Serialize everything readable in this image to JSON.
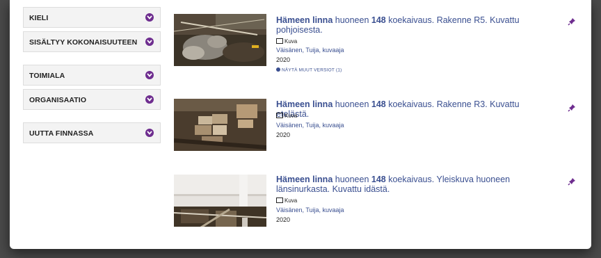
{
  "facets": [
    {
      "label": "KIELI"
    },
    {
      "label": "SISÄLTYY KOKONAISUUTEEN"
    },
    {
      "label": "TOIMIALA"
    },
    {
      "label": "ORGANISAATIO"
    },
    {
      "label": "UUTTA FINNASSA"
    }
  ],
  "results": [
    {
      "title_prefix": "Hämeen linna",
      "title_mid": " huoneen ",
      "title_num": "148",
      "title_rest": " koekaivaus. Rakenne R5. Kuvattu pohjoisesta.",
      "format": "Kuva",
      "author": "Väisänen, Tuija, kuvaaja",
      "year": "2020",
      "versions": "NÄYTÄ MUUT VERSIOT (1)"
    },
    {
      "title_prefix": "Hämeen linna",
      "title_mid": " huoneen ",
      "title_num": "148",
      "title_rest": " koekaivaus. Rakenne R3. Kuvattu etelästä.",
      "format": "Kuva",
      "author": "Väisänen, Tuija, kuvaaja",
      "year": "2020"
    },
    {
      "title_prefix": "Hämeen linna",
      "title_mid": " huoneen ",
      "title_num": "148",
      "title_rest": " koekaivaus. Yleiskuva huoneen länsinurkasta. Kuvattu idästä.",
      "format": "Kuva",
      "author": "Väisänen, Tuija, kuvaaja",
      "year": "2020"
    }
  ],
  "colors": {
    "accent": "#6e2d8f",
    "link": "#3a4f90"
  }
}
